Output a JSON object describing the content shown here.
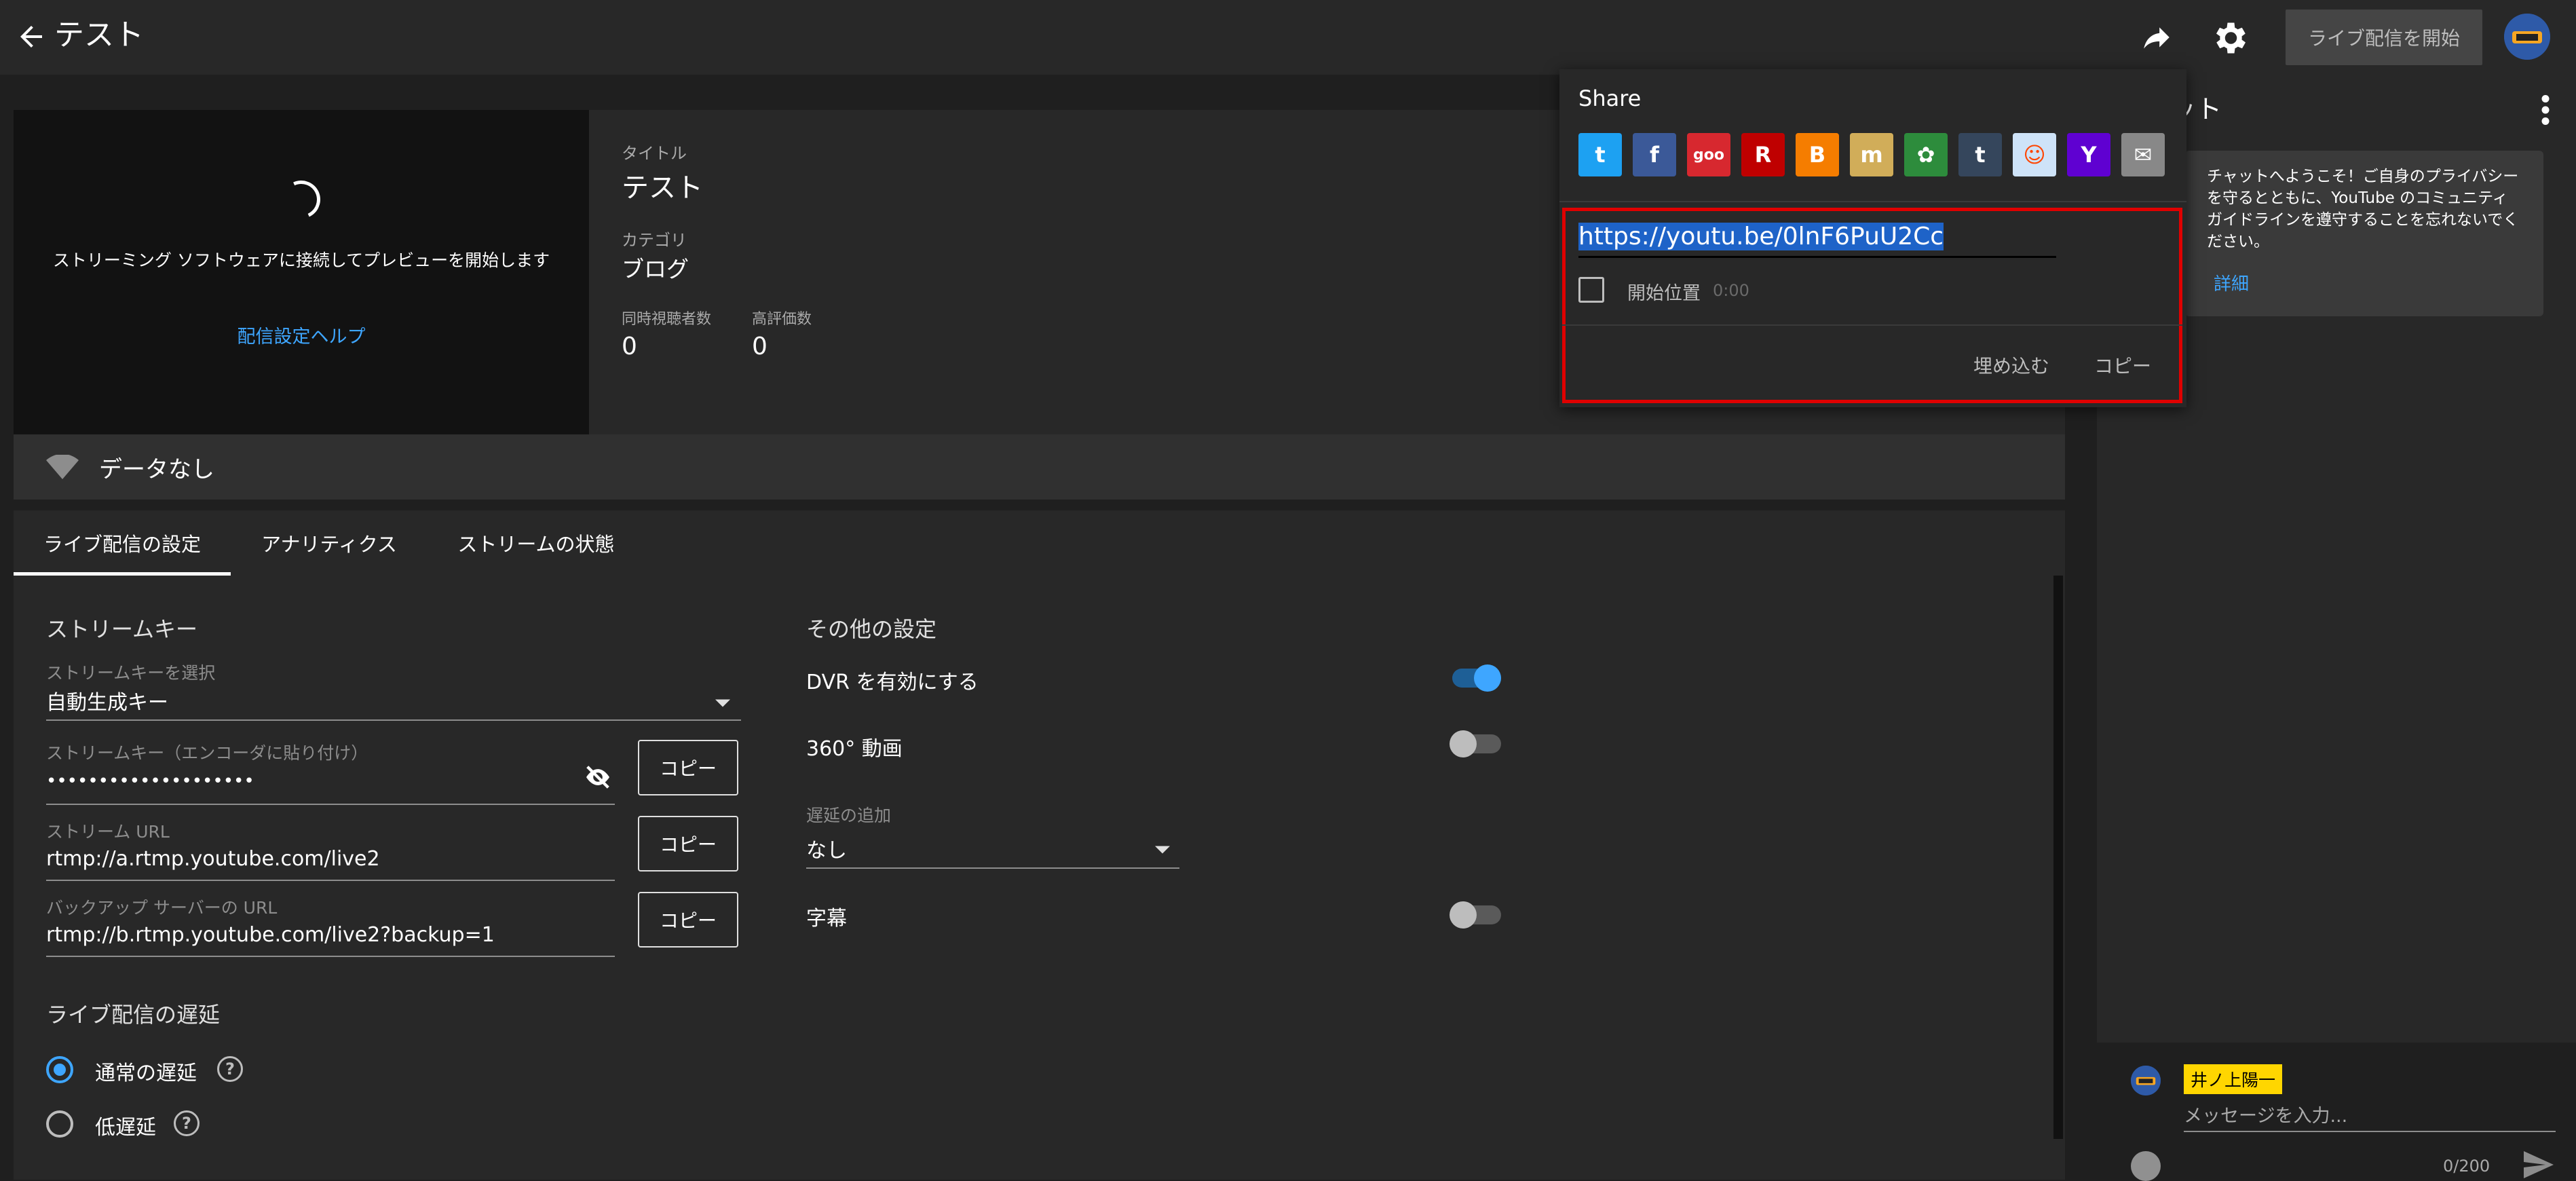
{
  "header": {
    "title": "テスト",
    "go_live_label": "ライブ配信を開始"
  },
  "preview": {
    "message": "ストリーミング ソフトウェアに接続してプレビューを開始します",
    "help_link": "配信設定ヘルプ"
  },
  "info": {
    "title_label": "タイトル",
    "title_value": "テスト",
    "category_label": "カテゴリ",
    "category_value": "ブログ",
    "viewers_label": "同時視聴者数",
    "viewers_value": "0",
    "likes_label": "高評価数",
    "likes_value": "0"
  },
  "status": {
    "data_label": "データなし"
  },
  "tabs": [
    {
      "label": "ライブ配信の設定"
    },
    {
      "label": "アナリティクス"
    },
    {
      "label": "ストリームの状態"
    }
  ],
  "stream_key": {
    "heading": "ストリームキー",
    "select_label": "ストリームキーを選択",
    "select_value": "自動生成キー",
    "key_label": "ストリームキー（エンコーダに貼り付け）",
    "key_value": "••••••••••••••••••••",
    "url_label": "ストリーム URL",
    "url_value": "rtmp://a.rtmp.youtube.com/live2",
    "backup_label": "バックアップ サーバーの URL",
    "backup_value": "rtmp://b.rtmp.youtube.com/live2?backup=1",
    "copy_label": "コピー"
  },
  "latency": {
    "heading": "ライブ配信の遅延",
    "normal": "通常の遅延",
    "low": "低遅延",
    "selected": "normal"
  },
  "other": {
    "heading": "その他の設定",
    "dvr_label": "DVR を有効にする",
    "dvr_on": true,
    "vr_label": "360° 動画",
    "vr_on": false,
    "delay_label": "遅延の追加",
    "delay_value": "なし",
    "captions_label": "字幕",
    "captions_on": false
  },
  "chat": {
    "title": "ャット",
    "welcome": "チャットへようこそ！ご自身のプライバシーを守るとともに、YouTube のコミュニティ ガイドラインを遵守することを忘れないでください。",
    "more": "詳細",
    "user": "井ノ上陽一",
    "input_placeholder": "メッセージを入力...",
    "count": "0/200"
  },
  "share": {
    "title": "Share",
    "services": [
      {
        "name": "twitter",
        "color": "#1da1f2",
        "glyph": "t"
      },
      {
        "name": "facebook",
        "color": "#3b5998",
        "glyph": "f"
      },
      {
        "name": "goo",
        "color": "#d7282f",
        "glyph": "goo"
      },
      {
        "name": "rakuten",
        "color": "#bf0000",
        "glyph": "R"
      },
      {
        "name": "blogger",
        "color": "#f57d00",
        "glyph": "B"
      },
      {
        "name": "mixi",
        "color": "#d1ad59",
        "glyph": "m"
      },
      {
        "name": "ameba",
        "color": "#2d8c3c",
        "glyph": "✿"
      },
      {
        "name": "tumblr",
        "color": "#35465c",
        "glyph": "t"
      },
      {
        "name": "reddit",
        "color": "#cee3f8",
        "glyph": "☺"
      },
      {
        "name": "yahoo",
        "color": "#5f01d1",
        "glyph": "Y"
      },
      {
        "name": "email",
        "color": "#888888",
        "glyph": "✉"
      }
    ],
    "url": "https://youtu.be/0lnF6PuU2Cc",
    "start_label": "開始位置",
    "start_time": "0:00",
    "embed_label": "埋め込む",
    "copy_label": "コピー"
  }
}
